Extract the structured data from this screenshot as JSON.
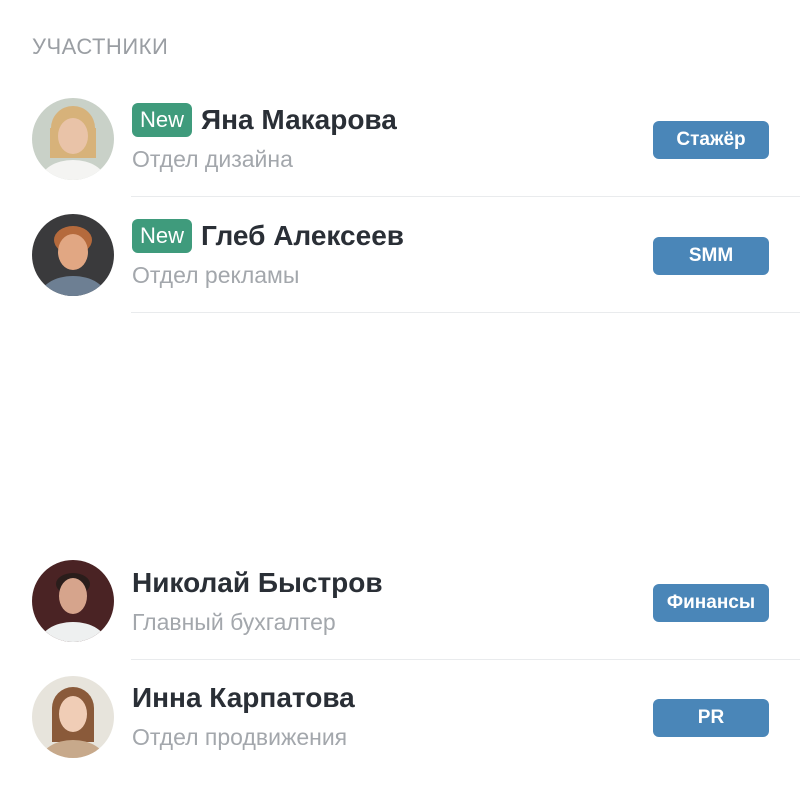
{
  "section": {
    "title": "УЧАСТНИКИ"
  },
  "members": [
    {
      "name": "Яна Макарова",
      "department": "Отдел дизайна",
      "badge": "New",
      "tag": "Стажёр",
      "avatar_colors": {
        "bg": "#c9d1c8",
        "hair": "#d7b27a",
        "skin": "#e9c3a8",
        "shirt": "#f4f4f2"
      }
    },
    {
      "name": "Глеб Алексеев",
      "department": "Отдел рекламы",
      "badge": "New",
      "tag": "SMM",
      "avatar_colors": {
        "bg": "#3a3a3c",
        "hair": "#b56a3c",
        "skin": "#e1a783",
        "shirt": "#6d7f93"
      }
    },
    {
      "name": "Николай Быстров",
      "department": "Главный бухгалтер",
      "badge": "",
      "tag": "Финансы",
      "avatar_colors": {
        "bg": "#4a2324",
        "hair": "#2a1d1b",
        "skin": "#d6a48c",
        "shirt": "#eef0f0"
      }
    },
    {
      "name": "Инна Карпатова",
      "department": "Отдел продвижения",
      "badge": "",
      "tag": "PR",
      "avatar_colors": {
        "bg": "#e7e4dc",
        "hair": "#8a5a3a",
        "skin": "#f0cdb6",
        "shirt": "#c7a98b"
      }
    }
  ],
  "colors": {
    "new_badge": "#3f9b7c",
    "tag": "#4a86b8",
    "name": "#2a2f36",
    "muted": "#a3a7ac"
  }
}
